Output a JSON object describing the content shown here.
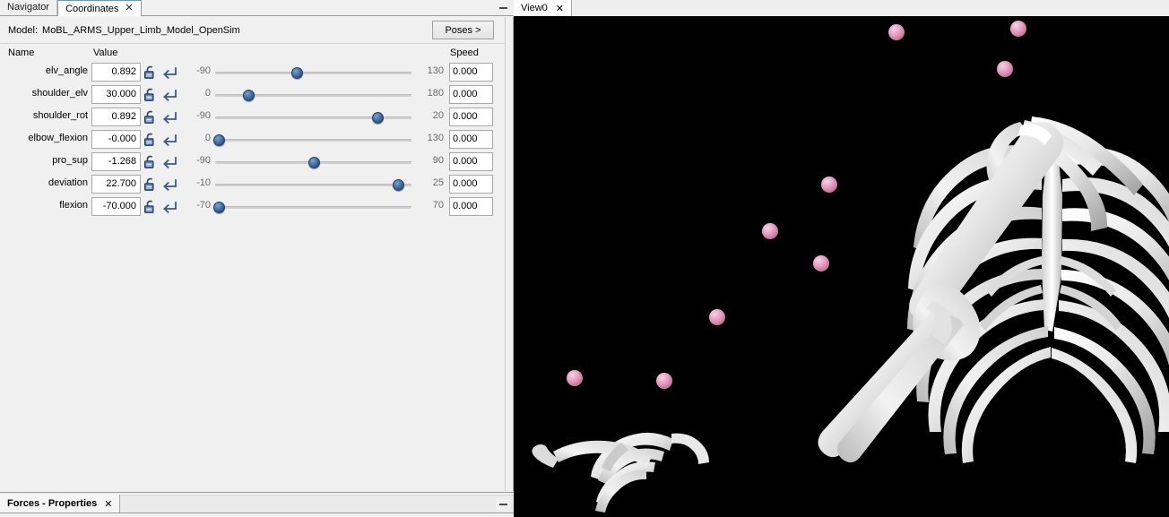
{
  "left_dock": {
    "tabs": [
      {
        "label": "Navigator",
        "active": false,
        "closable": false
      },
      {
        "label": "Coordinates",
        "active": true,
        "closable": true,
        "close_glyph": "✕"
      }
    ],
    "minimize_label": "minimize",
    "model": {
      "label": "Model:",
      "name": "MoBL_ARMS_Upper_Limb_Model_OpenSim"
    },
    "poses_button": "Poses >",
    "columns": {
      "name": "Name",
      "value": "Value",
      "speed": "Speed"
    },
    "coordinates": [
      {
        "name": "elv_angle",
        "value": "0.892",
        "min": "-90",
        "max": "130",
        "speed": "0.000",
        "thumb_pct": 41.5,
        "lock_icon": "unlock-icon",
        "reset_icon": "reset-arrow-icon"
      },
      {
        "name": "shoulder_elv",
        "value": "30.000",
        "min": "0",
        "max": "180",
        "speed": "0.000",
        "thumb_pct": 16.7,
        "lock_icon": "unlock-icon",
        "reset_icon": "reset-arrow-icon"
      },
      {
        "name": "shoulder_rot",
        "value": "0.892",
        "min": "-90",
        "max": "20",
        "speed": "0.000",
        "thumb_pct": 82.6,
        "lock_icon": "unlock-icon",
        "reset_icon": "reset-arrow-icon"
      },
      {
        "name": "elbow_flexion",
        "value": "-0.000",
        "min": "0",
        "max": "130",
        "speed": "0.000",
        "thumb_pct": 2.0,
        "lock_icon": "unlock-icon",
        "reset_icon": "reset-arrow-icon"
      },
      {
        "name": "pro_sup",
        "value": "-1.268",
        "min": "-90",
        "max": "90",
        "speed": "0.000",
        "thumb_pct": 50.0,
        "lock_icon": "unlock-icon",
        "reset_icon": "reset-arrow-icon"
      },
      {
        "name": "deviation",
        "value": "22.700",
        "min": "-10",
        "max": "25",
        "speed": "0.000",
        "thumb_pct": 93.0,
        "lock_icon": "unlock-icon",
        "reset_icon": "reset-arrow-icon"
      },
      {
        "name": "flexion",
        "value": "-70.000",
        "min": "-70",
        "max": "70",
        "speed": "0.000",
        "thumb_pct": 2.0,
        "lock_icon": "unlock-icon",
        "reset_icon": "reset-arrow-icon"
      }
    ]
  },
  "bottom_dock": {
    "tabs": [
      {
        "label": "Forces - Properties",
        "active": true,
        "closable": true,
        "close_glyph": "✕"
      }
    ],
    "minimize_label": "minimize"
  },
  "right_dock": {
    "tabs": [
      {
        "label": "View0",
        "active": true,
        "closable": true,
        "close_glyph": "✕"
      }
    ],
    "scene": {
      "background": "#000000",
      "bone_color": "#f0f0f0",
      "marker_color": "#e59ec2",
      "description": "3D skeletal upper-limb model: rib cage, clavicle, scapula, humerus, radius/ulna and hand with pink spherical markers"
    }
  },
  "colors": {
    "panel_bg": "#f0f0f0",
    "field_bg": "#ffffff",
    "border": "#a9a9a9",
    "slider_thumb": "#3a6496",
    "slider_track": "#cfcfcf",
    "range_text": "#6b6b6b",
    "active_tab_accent": "#5a9fd4",
    "viewport_bg": "#000000",
    "marker_pink": "#e59ec2"
  }
}
